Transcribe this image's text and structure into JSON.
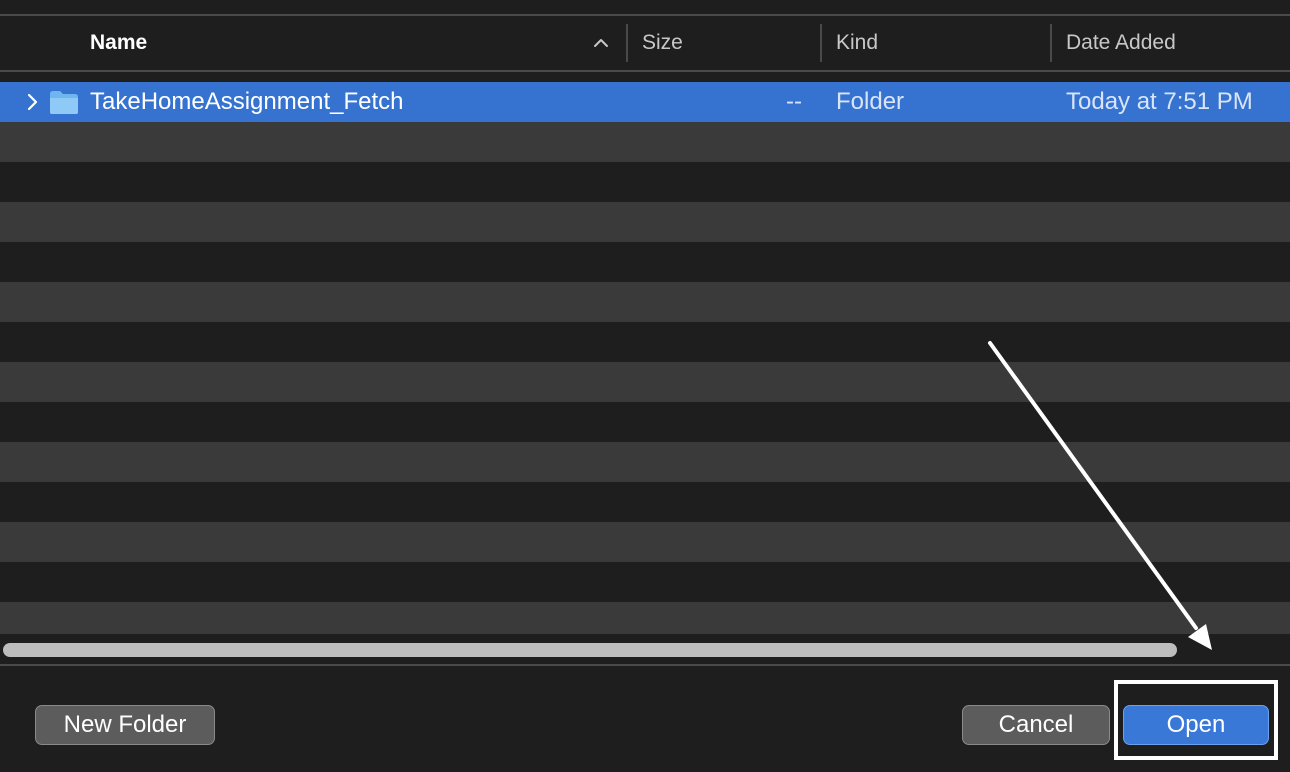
{
  "columns": {
    "name": "Name",
    "size": "Size",
    "kind": "Kind",
    "date_added": "Date Added"
  },
  "files": [
    {
      "name": "TakeHomeAssignment_Fetch",
      "size": "--",
      "kind": "Folder",
      "date_added": "Today at 7:51 PM",
      "selected": true,
      "icon": "folder-icon"
    }
  ],
  "buttons": {
    "new_folder": "New Folder",
    "cancel": "Cancel",
    "open": "Open"
  },
  "colors": {
    "selection": "#3673d1",
    "primary_button": "#3a78d8",
    "background": "#1e1e1e",
    "stripe": "#3a3a3a"
  }
}
